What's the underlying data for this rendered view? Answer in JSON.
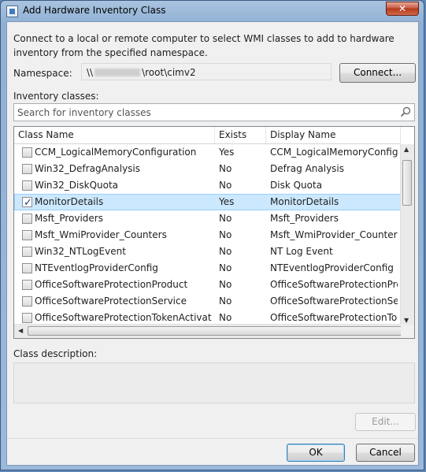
{
  "window": {
    "title": "Add Hardware Inventory Class",
    "close_glyph": "✕"
  },
  "intro_text": "Connect to a local or remote computer to select WMI classes to add to hardware inventory from the specified namespace.",
  "namespace": {
    "label": "Namespace:",
    "prefix": "\\\\",
    "value": "\\root\\cimv2"
  },
  "connect_label": "Connect...",
  "inventory_label": "Inventory classes:",
  "search_placeholder": "Search for inventory classes",
  "columns": {
    "class_name": "Class Name",
    "exists": "Exists",
    "display_name": "Display Name"
  },
  "rows": [
    {
      "class_name": "CCM_LogicalMemoryConfiguration",
      "exists": "Yes",
      "display_name": "CCM_LogicalMemoryConfigur",
      "checked": false
    },
    {
      "class_name": "Win32_DefragAnalysis",
      "exists": "No",
      "display_name": "Defrag Analysis",
      "checked": false
    },
    {
      "class_name": "Win32_DiskQuota",
      "exists": "No",
      "display_name": "Disk Quota",
      "checked": false
    },
    {
      "class_name": "MonitorDetails",
      "exists": "Yes",
      "display_name": "MonitorDetails",
      "checked": true
    },
    {
      "class_name": "Msft_Providers",
      "exists": "No",
      "display_name": "Msft_Providers",
      "checked": false
    },
    {
      "class_name": "Msft_WmiProvider_Counters",
      "exists": "No",
      "display_name": "Msft_WmiProvider_Counters",
      "checked": false
    },
    {
      "class_name": "Win32_NTLogEvent",
      "exists": "No",
      "display_name": "NT Log Event",
      "checked": false
    },
    {
      "class_name": "NTEventlogProviderConfig",
      "exists": "No",
      "display_name": "NTEventlogProviderConfig",
      "checked": false
    },
    {
      "class_name": "OfficeSoftwareProtectionProduct",
      "exists": "No",
      "display_name": "OfficeSoftwareProtectionProd",
      "checked": false
    },
    {
      "class_name": "OfficeSoftwareProtectionService",
      "exists": "No",
      "display_name": "OfficeSoftwareProtectionServi",
      "checked": false
    },
    {
      "class_name": "OfficeSoftwareProtectionTokenActivationI",
      "exists": "No",
      "display_name": "OfficeSoftwareProtectionToke",
      "checked": false
    }
  ],
  "description_label": "Class description:",
  "edit_label": "Edit...",
  "ok_label": "OK",
  "cancel_label": "Cancel",
  "colors": {
    "selected_row": "#cce8ff",
    "title_bar": "#9bb9da",
    "close_button": "#c95b43"
  },
  "icons": {
    "search": "search-icon",
    "window": "window-icon"
  }
}
